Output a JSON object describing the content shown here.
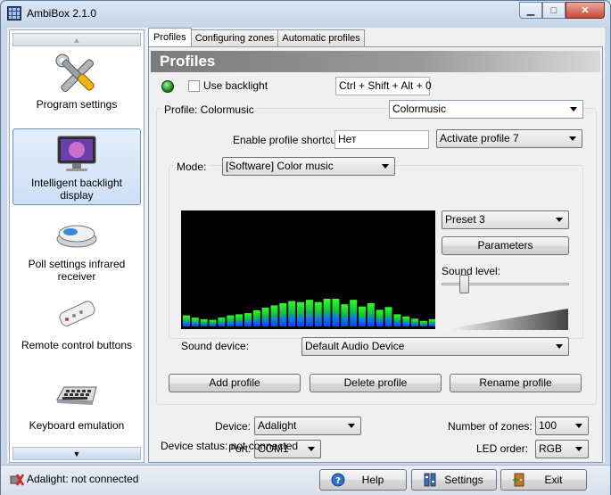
{
  "window": {
    "title": "AmbiBox 2.1.0",
    "minimize_glyph": "▁",
    "maximize_glyph": "□",
    "close_glyph": "✕"
  },
  "sidebar": {
    "scroll_up": "▲",
    "scroll_down": "▼",
    "items": [
      {
        "label": "Program settings",
        "icon": "tools-icon"
      },
      {
        "label": "Intelligent backlight display",
        "icon": "monitor-icon",
        "selected": true
      },
      {
        "label": "Poll settings infrared receiver",
        "icon": "ir-receiver-icon"
      },
      {
        "label": "Remote control buttons",
        "icon": "remote-control-icon"
      },
      {
        "label": "Keyboard emulation",
        "icon": "keyboard-icon"
      }
    ]
  },
  "tabs": [
    {
      "label": "Profiles",
      "active": true
    },
    {
      "label": "Configuring zones"
    },
    {
      "label": "Automatic profiles"
    }
  ],
  "profiles": {
    "header": "Profiles",
    "use_backlight_label": "Use backlight",
    "use_backlight_checked": false,
    "backlight_shortcut": "Ctrl + Shift + Alt + 0",
    "profile_group_label": "Profile: Colormusic",
    "profile_select": "Colormusic",
    "enable_shortcut_label": "Enable profile shortcut:",
    "enable_shortcut_value": "Нет",
    "activate_profile": "Activate profile 7",
    "mode_label": "Mode:",
    "mode_value": "[Software] Color music",
    "preset": "Preset 3",
    "parameters_button": "Parameters",
    "sound_level_label": "Sound level:",
    "sound_level": 0.15,
    "sound_device_label": "Sound device:",
    "sound_device": "Default Audio Device",
    "add_profile": "Add profile",
    "delete_profile": "Delete profile",
    "rename_profile": "Rename profile",
    "spectrum": [
      20,
      16,
      13,
      12,
      16,
      20,
      22,
      24,
      29,
      34,
      38,
      42,
      46,
      44,
      48,
      44,
      50,
      50,
      40,
      48,
      36,
      42,
      30,
      35,
      22,
      18,
      14,
      10,
      13
    ]
  },
  "device": {
    "device_label": "Device:",
    "device_value": "Adalight",
    "port_label": "Port:",
    "port_value": "COM1",
    "zones_label": "Number of zones:",
    "zones_value": "100",
    "led_order_label": "LED order:",
    "led_order_value": "RGB",
    "status_text": "Device status: not connected"
  },
  "statusbar": {
    "connection_text": "Adalight: not connected",
    "help": "Help",
    "settings": "Settings",
    "exit": "Exit"
  },
  "colors": {
    "led_green": "#1f8a1f",
    "selection": "#cfe0f5",
    "header_gray": "#7b7b7b"
  }
}
